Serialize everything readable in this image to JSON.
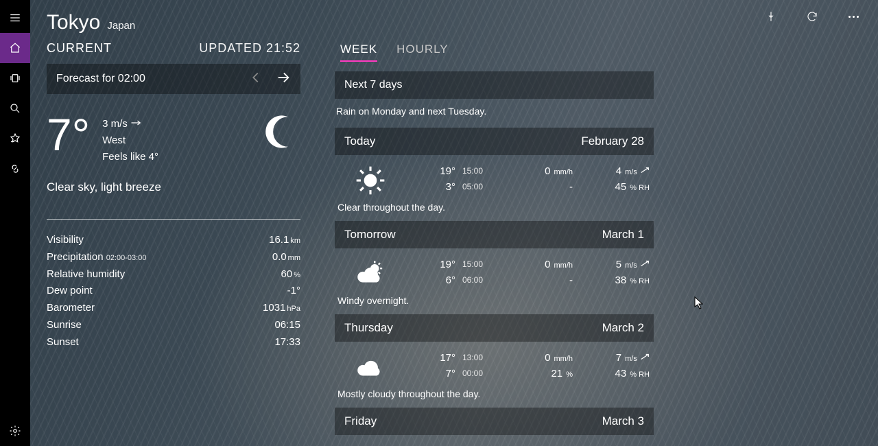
{
  "location": {
    "city": "Tokyo",
    "country": "Japan"
  },
  "current": {
    "heading": "CURRENT",
    "updated_label": "UPDATED 21:52",
    "forecast_for": "Forecast for 02:00",
    "temp": "7°",
    "wind_speed": "3 m/s",
    "wind_dir": "West",
    "feels_like": "Feels like 4°",
    "summary": "Clear sky, light breeze"
  },
  "stats": {
    "visibility": {
      "label": "Visibility",
      "value": "16.1",
      "unit": "km"
    },
    "precip": {
      "label": "Precipitation",
      "sub": "02:00-03:00",
      "value": "0.0",
      "unit": "mm"
    },
    "humidity": {
      "label": "Relative humidity",
      "value": "60",
      "unit": "%"
    },
    "dewpoint": {
      "label": "Dew point",
      "value": "-1°"
    },
    "barometer": {
      "label": "Barometer",
      "value": "1031",
      "unit": "hPa"
    },
    "sunrise": {
      "label": "Sunrise",
      "value": "06:15"
    },
    "sunset": {
      "label": "Sunset",
      "value": "17:33"
    }
  },
  "tabs": {
    "week": "WEEK",
    "hourly": "HOURLY"
  },
  "week": {
    "title": "Next 7 days",
    "sub": "Rain on Monday and next Tuesday.",
    "days": [
      {
        "name": "Today",
        "date": "February 28",
        "icon": "sun",
        "hi": "19°",
        "hi_time": "15:00",
        "lo": "3°",
        "lo_time": "05:00",
        "precip": "0",
        "precip_unit": "mm/h",
        "precip2": "-",
        "wind": "4",
        "wind_unit": "m/s",
        "rh": "45",
        "rh_unit": "% RH",
        "desc": "Clear throughout the day."
      },
      {
        "name": "Tomorrow",
        "date": "March 1",
        "icon": "partly",
        "hi": "19°",
        "hi_time": "15:00",
        "lo": "6°",
        "lo_time": "06:00",
        "precip": "0",
        "precip_unit": "mm/h",
        "precip2": "-",
        "wind": "5",
        "wind_unit": "m/s",
        "rh": "38",
        "rh_unit": "% RH",
        "desc": "Windy overnight."
      },
      {
        "name": "Thursday",
        "date": "March 2",
        "icon": "cloud",
        "hi": "17°",
        "hi_time": "13:00",
        "lo": "7°",
        "lo_time": "00:00",
        "precip": "0",
        "precip_unit": "mm/h",
        "precip2": "21",
        "precip2_unit": "%",
        "wind": "7",
        "wind_unit": "m/s",
        "rh": "43",
        "rh_unit": "% RH",
        "desc": "Mostly cloudy throughout the day."
      },
      {
        "name": "Friday",
        "date": "March 3"
      }
    ]
  }
}
